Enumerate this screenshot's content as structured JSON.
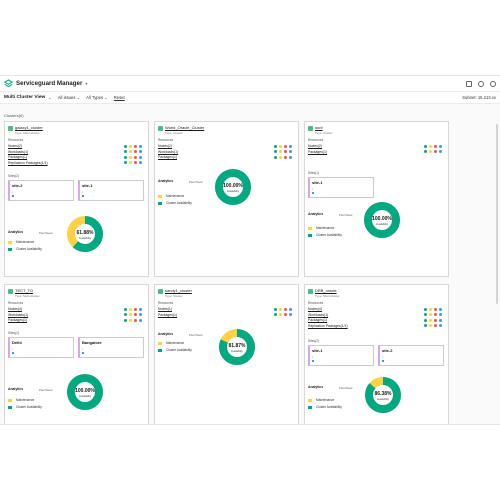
{
  "app": {
    "title": "Serviceguard Manager"
  },
  "toolbar": {
    "view_title": "Multi Cluster View",
    "filter_issues": "All issues",
    "filter_types": "All Types",
    "reset": "Reset",
    "subnet": "Subnet: 15.213.xx"
  },
  "section_label": "Clusters(6)",
  "analytics_label": "Analytics",
  "analytics_tab": "Past Week",
  "resources_label": "Resources",
  "legend": {
    "maintenance": "Maintenance",
    "availability": "Cluster Availability"
  },
  "colors": {
    "accent": "#01a982",
    "maintenance": "#ffd144",
    "site_border": "#d7a8e8"
  },
  "cards": [
    {
      "name": "galaxy1_cluster",
      "type": "Type: Metrocluster",
      "resources": [
        "Nodes(2)",
        "Workloads(1)",
        "Packages(1)",
        "Replication Packages(1/1)"
      ],
      "sites_label": "Sites(2)",
      "sites": [
        "site-2",
        "site-1"
      ],
      "availability": 61.88,
      "availability_text": "61.88%",
      "availability_caption": "Availability"
    },
    {
      "name": "World_Oracle_Cluster",
      "type": "Type: Cluster",
      "resources": [
        "Nodes(2)",
        "Workloads(1)",
        "Packages(1)"
      ],
      "sites_label": "",
      "sites": [],
      "availability": 100,
      "availability_text": "100.00%",
      "availability_caption": "Availability"
    },
    {
      "name": "sunf",
      "type": "Type: Cluster",
      "resources": [
        "Nodes(2)",
        "Packages(1)"
      ],
      "sites_label": "Sites(1)",
      "sites": [
        "site-1"
      ],
      "availability": 100,
      "availability_text": "100.00%",
      "availability_caption": "Availability"
    },
    {
      "name": "TECT_TO",
      "type": "Type: Metrocluster",
      "resources": [
        "Nodes(4)",
        "Workloads(1)",
        "Packages(1)"
      ],
      "sites_label": "Sites(2)",
      "sites": [
        "Delhi",
        "Bangalore"
      ],
      "availability": 100,
      "availability_text": "100.00%",
      "availability_caption": "Availability"
    },
    {
      "name": "sandy1_cluster",
      "type": "Type: Cluster",
      "resources": [
        "Nodes(1)",
        "Packages(1)"
      ],
      "sites_label": "",
      "sites": [],
      "availability": 81.87,
      "availability_text": "81.87%",
      "availability_caption": "Availability"
    },
    {
      "name": "DRB_oracle",
      "type": "Type: Metrocluster",
      "resources": [
        "Nodes(4)",
        "Workloads(1)",
        "Packages(1)",
        "Replication Packages(1/1)"
      ],
      "sites_label": "Sites(2)",
      "sites": [
        "site-1",
        "site-2"
      ],
      "availability": 86.38,
      "availability_text": "86.38%",
      "availability_caption": "Availability"
    }
  ]
}
